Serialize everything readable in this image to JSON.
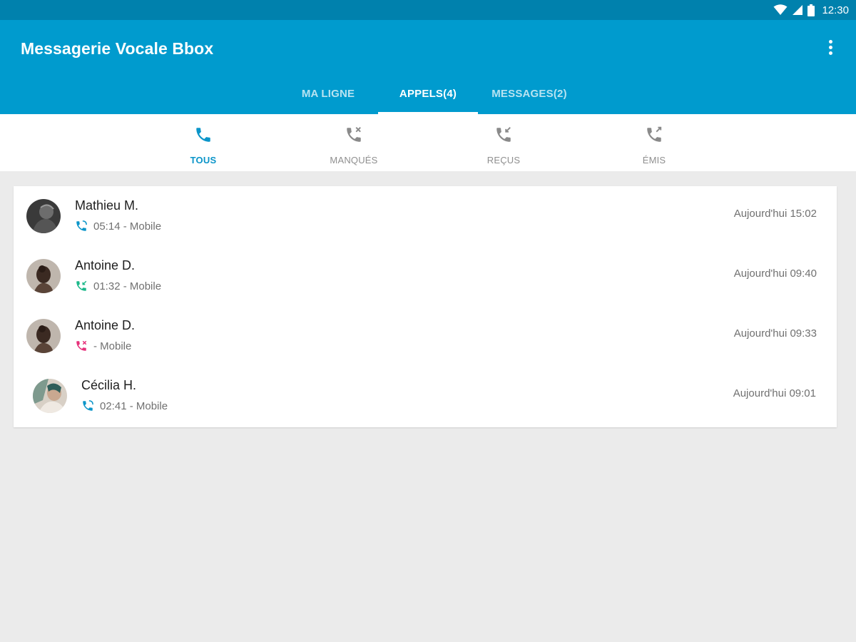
{
  "status_bar": {
    "time": "12:30",
    "icons": [
      "wifi-icon",
      "signal-icon",
      "battery-icon"
    ]
  },
  "app_bar": {
    "title": "Messagerie Vocale Bbox",
    "menu_icon": "overflow-menu-icon",
    "background_color": "#009bce"
  },
  "tabs": [
    {
      "label": "MA LIGNE",
      "active": false
    },
    {
      "label": "APPELS(4)",
      "active": true
    },
    {
      "label": "MESSAGES(2)",
      "active": false
    }
  ],
  "filters": [
    {
      "label": "TOUS",
      "icon": "phone-icon",
      "active": true
    },
    {
      "label": "MANQUÉS",
      "icon": "missed-call-icon",
      "active": false
    },
    {
      "label": "REÇUS",
      "icon": "incoming-call-icon",
      "active": false
    },
    {
      "label": "ÉMIS",
      "icon": "outgoing-call-icon",
      "active": false
    }
  ],
  "calls": [
    {
      "name": "Mathieu M.",
      "detail": "05:14 - Mobile",
      "time": "Aujourd'hui 15:02",
      "type_icon": "phone-icon",
      "type_color": "#0b95c9"
    },
    {
      "name": "Antoine D.",
      "detail": "01:32 - Mobile",
      "time": "Aujourd'hui 09:40",
      "type_icon": "incoming-call-icon",
      "type_color": "#1cb88a"
    },
    {
      "name": "Antoine D.",
      "detail": " - Mobile",
      "time": "Aujourd'hui 09:33",
      "type_icon": "missed-call-icon",
      "type_color": "#e6307a"
    },
    {
      "name": "Cécilia H.",
      "detail": "02:41 - Mobile",
      "time": "Aujourd'hui 09:01",
      "type_icon": "phone-icon",
      "type_color": "#0b95c9"
    }
  ],
  "colors": {
    "accent": "#0b95c9",
    "status_bar": "#0081ad",
    "background": "#ebebeb"
  }
}
